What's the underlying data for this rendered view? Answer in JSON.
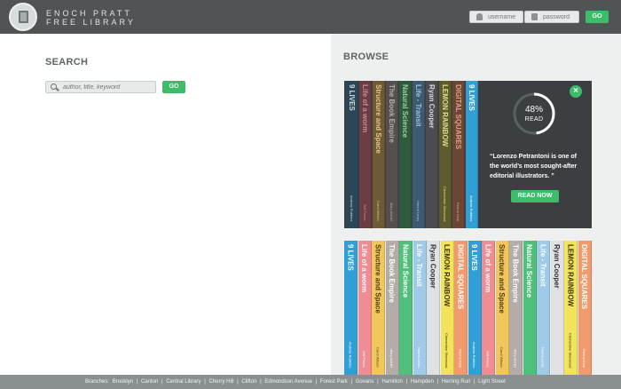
{
  "header": {
    "brand_line1": "ENOCH PRATT",
    "brand_line2": "FREE LIBRARY",
    "username_placeholder": "username",
    "password_placeholder": "password",
    "go_label": "GO"
  },
  "search": {
    "title": "SEARCH",
    "placeholder": "author, title, keyword",
    "go_label": "GO"
  },
  "browse": {
    "title": "BROWSE",
    "feature": {
      "percent": "48%",
      "read_label": "READ",
      "progress": 0.48,
      "quote": "“Lorenzo Petrantoni is one of the world’s most sought-after editorial illustrators. ”",
      "read_now_label": "READ NOW",
      "close_label": "×"
    },
    "feature_spines": [
      {
        "title": "9 LIVES",
        "author": "Andrew Robbins",
        "bg": "#2b4656",
        "fg": "#cfd9de"
      },
      {
        "title": "Life of a worm",
        "author": "Will Flores",
        "bg": "#6a3d44",
        "fg": "#c98b92"
      },
      {
        "title": "Structure and Space",
        "author": "Carol Wilson",
        "bg": "#6e5a35",
        "fg": "#e2c98e"
      },
      {
        "title": "The Book Empire",
        "author": "Mary Aichel",
        "bg": "#56504d",
        "fg": "#b4aca8"
      },
      {
        "title": "Natural Science",
        "author": "",
        "bg": "#2f5a3d",
        "fg": "#9ccfa9"
      },
      {
        "title": "Life - Transit",
        "author": "Hanna Lewis",
        "bg": "#3c5a70",
        "fg": "#9fc2db"
      },
      {
        "title": "Ryan Cooper",
        "author": "",
        "bg": "#4a4c4e",
        "fg": "#d8dadb"
      },
      {
        "title": "LEMON RAINBOW",
        "author": "Clementine Sherwood",
        "bg": "#5e5b2c",
        "fg": "#e0dc8f"
      },
      {
        "title": "DIGITAL SQUARES",
        "author": "Reena Kirai",
        "bg": "#6b4634",
        "fg": "#d9a386"
      },
      {
        "title": "9 LIVES",
        "author": "Andrew Robbins",
        "bg": "#2f9fd6",
        "fg": "#ffffff"
      }
    ],
    "shelf_spines": [
      {
        "title": "9 LIVES",
        "author": "Andrew Robbins",
        "bg": "#2f9fd6",
        "fg": "#ffffff"
      },
      {
        "title": "Life of a worm",
        "author": "Will Flores",
        "bg": "#f08c93",
        "fg": "#ffffff"
      },
      {
        "title": "Structure and Space",
        "author": "Carol Wilson",
        "bg": "#f1c75c",
        "fg": "#4a3a15"
      },
      {
        "title": "The Book Empire",
        "author": "Mary Aichel",
        "bg": "#b3aca8",
        "fg": "#ffffff"
      },
      {
        "title": "Natural Science",
        "author": "",
        "bg": "#4fbf79",
        "fg": "#ffffff"
      },
      {
        "title": "Life - Transit",
        "author": "Hanna Lewis",
        "bg": "#9fcbe9",
        "fg": "#ffffff"
      },
      {
        "title": "Ryan Cooper",
        "author": "",
        "bg": "#dfe1e2",
        "fg": "#2f3335"
      },
      {
        "title": "LEMON RAINBOW",
        "author": "Clementine Sherwood",
        "bg": "#f2e35a",
        "fg": "#3a3710"
      },
      {
        "title": "DIGITAL SQUARES",
        "author": "Reena Kirai",
        "bg": "#f19a6d",
        "fg": "#ffffff"
      },
      {
        "title": "9 LIVES",
        "author": "Andrew Robbins",
        "bg": "#2f9fd6",
        "fg": "#ffffff"
      },
      {
        "title": "Life of a worm",
        "author": "Will Flores",
        "bg": "#f08c93",
        "fg": "#ffffff"
      },
      {
        "title": "Structure and Space",
        "author": "Carol Wilson",
        "bg": "#f1c75c",
        "fg": "#4a3a15"
      },
      {
        "title": "The Book Empire",
        "author": "Mary Aichel",
        "bg": "#b3aca8",
        "fg": "#ffffff"
      },
      {
        "title": "Natural Science",
        "author": "",
        "bg": "#4fbf79",
        "fg": "#ffffff"
      },
      {
        "title": "Life - Transit",
        "author": "Hanna Lewis",
        "bg": "#9fcbe9",
        "fg": "#ffffff"
      },
      {
        "title": "Ryan Cooper",
        "author": "",
        "bg": "#dfe1e2",
        "fg": "#2f3335"
      },
      {
        "title": "LEMON RAINBOW",
        "author": "Clementine Sherwood",
        "bg": "#f2e35a",
        "fg": "#3a3710"
      },
      {
        "title": "DIGITAL SQUARES",
        "author": "Reena Kirai",
        "bg": "#f19a6d",
        "fg": "#ffffff"
      }
    ]
  },
  "footer": {
    "branches_label": "Branches:",
    "branches": [
      "Brooklyn",
      "Canton",
      "Central Library",
      "Cherry Hill",
      "Clifton",
      "Edmondson Avenue",
      "Forest Park",
      "Govans",
      "Hamilton",
      "Hampden",
      "Herring Run",
      "Light Street"
    ]
  },
  "colors": {
    "header_bg": "#505456",
    "accent_green": "#3dbd6a",
    "panel_bg": "#eef0f0",
    "footer_bg": "#8a8f91"
  }
}
